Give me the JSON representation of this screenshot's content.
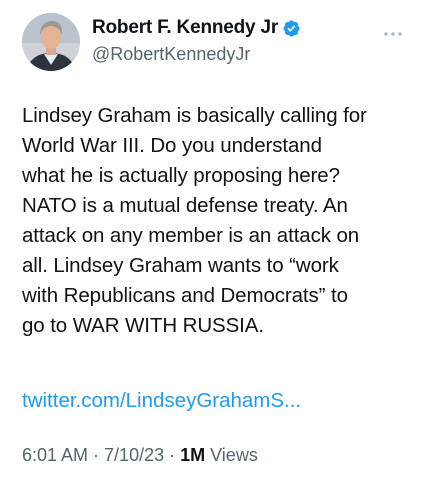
{
  "author": {
    "display_name": "Robert F. Kennedy Jr",
    "handle": "@RobertKennedyJr",
    "verified": true,
    "avatar_icon": "profile-photo"
  },
  "tweet": {
    "text": "Lindsey Graham is basically calling for\nWorld War III. Do you understand\nwhat he is actually proposing here?\nNATO is a mutual defense treaty. An\nattack on any member is an attack on\nall. Lindsey Graham wants to “work\nwith Republicans and Democrats” to\ngo to WAR WITH RUSSIA.",
    "link_text": "twitter.com/LindseyGrahamS..."
  },
  "meta": {
    "time": "6:01 AM",
    "separator": " · ",
    "date": "7/10/23",
    "views_count": "1M",
    "views_label": " Views"
  },
  "colors": {
    "text": "#0f1419",
    "secondary": "#536471",
    "link": "#1d9bf0",
    "verified_badge": "#1d9bf0"
  },
  "icons": {
    "verified": "verified-badge-icon",
    "more": "more-options-icon"
  }
}
